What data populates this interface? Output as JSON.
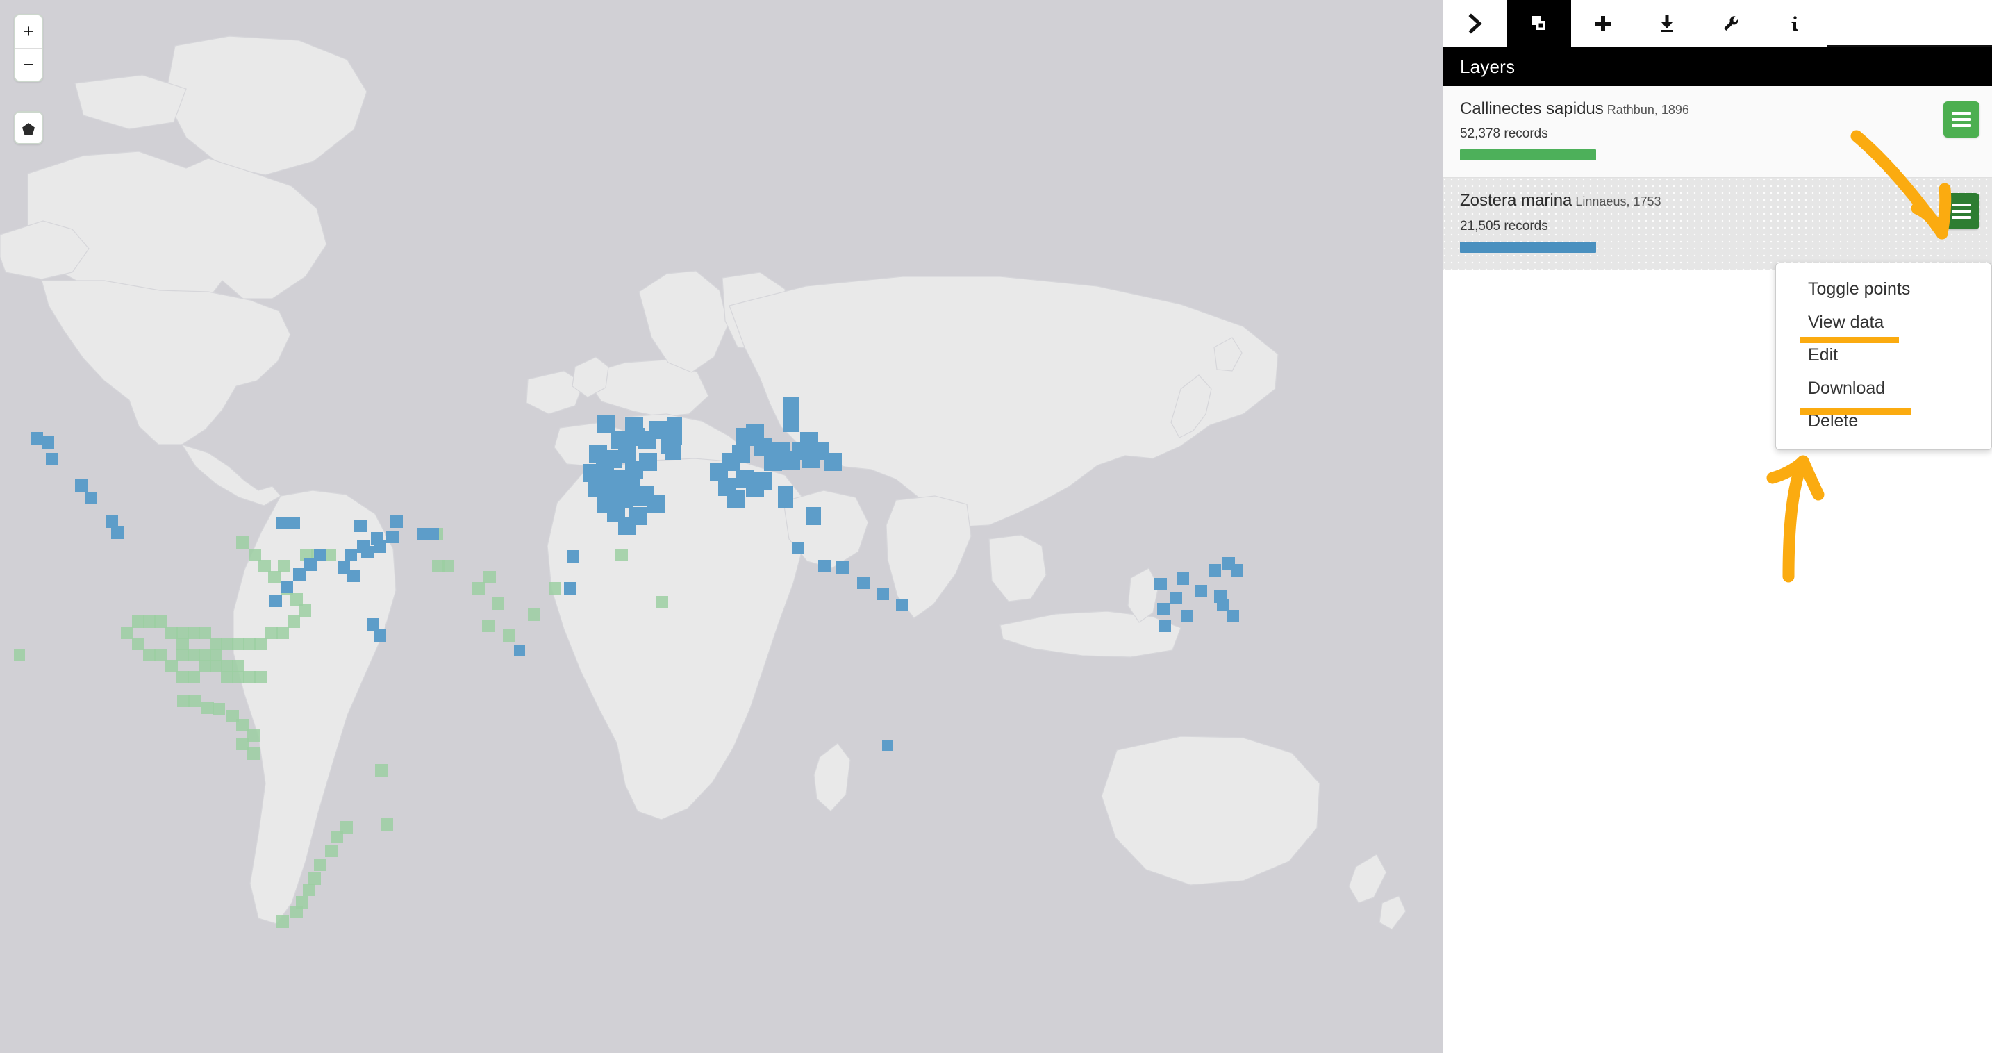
{
  "app": {
    "accent_orange": "#FBAB10",
    "panel_header_bg": "#000000",
    "map_ocean_color": "#d1d0d5",
    "map_land_color": "#e9e9e9"
  },
  "map": {
    "controls": {
      "zoom_in_label": "+",
      "zoom_out_label": "−",
      "zoom_in_icon": "plus-icon",
      "zoom_out_icon": "minus-icon",
      "draw_polygon_icon": "pentagon-polygon-icon"
    }
  },
  "toolbar": {
    "items": [
      {
        "icon": "chevron-right-icon",
        "name": "collapse-panel-button",
        "active": false
      },
      {
        "icon": "layers-icon",
        "name": "tab-layers",
        "active": true
      },
      {
        "icon": "plus-icon",
        "name": "tab-add-layer",
        "active": false
      },
      {
        "icon": "download-icon",
        "name": "tab-download",
        "active": false
      },
      {
        "icon": "wrench-icon",
        "name": "tab-tools",
        "active": false
      },
      {
        "icon": "info-icon",
        "name": "tab-info",
        "active": false
      }
    ]
  },
  "panel": {
    "header": {
      "title": "Layers"
    },
    "layers": [
      {
        "name": "Callinectes sapidus",
        "authority": "Rathbun, 1896",
        "records": "52,378 records",
        "color": "#4DB05A",
        "menu_button_color": "#4CAF50",
        "menu_open": false
      },
      {
        "name": "Zostera marina",
        "authority": "Linnaeus, 1753",
        "records": "21,505 records",
        "color": "#4A90BF",
        "menu_button_color": "#2E7D32",
        "menu_open": true
      }
    ]
  },
  "layer_menu": {
    "items": [
      {
        "label": "Toggle points",
        "name": "menu-item-toggle-points",
        "underlined": false
      },
      {
        "label": "View data",
        "name": "menu-item-view-data",
        "underlined": true
      },
      {
        "label": "Edit",
        "name": "menu-item-edit",
        "underlined": false
      },
      {
        "label": "Download",
        "name": "menu-item-download",
        "underlined": true
      },
      {
        "label": "Delete",
        "name": "menu-item-delete",
        "underlined": false
      }
    ]
  },
  "annotations": {
    "arrow_color": "#FBAB10",
    "arrows": [
      {
        "name": "annotation-arrow-to-layer-menu-button",
        "direction": "down-right"
      },
      {
        "name": "annotation-arrow-to-menu-items",
        "direction": "up"
      }
    ],
    "underlines": [
      {
        "name": "annotation-underline-view-data"
      },
      {
        "name": "annotation-underline-download"
      }
    ]
  }
}
